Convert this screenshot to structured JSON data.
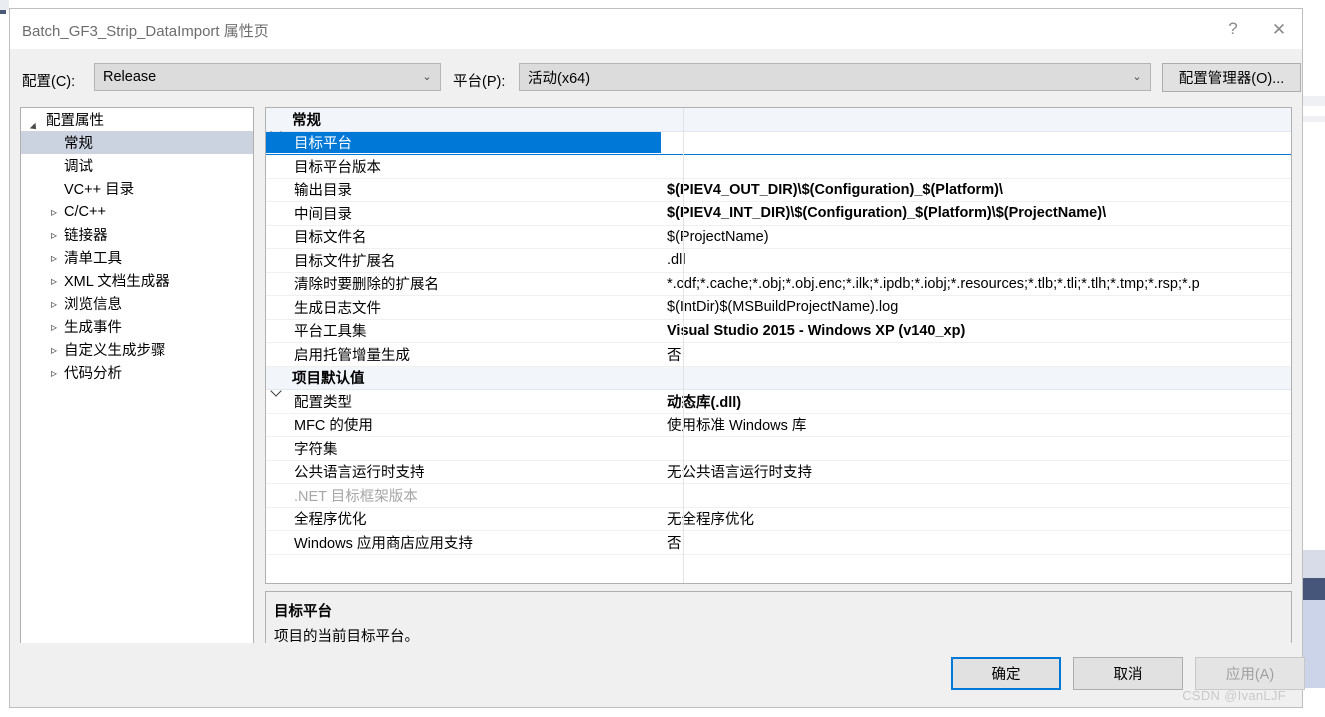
{
  "window": {
    "title": "Batch_GF3_Strip_DataImport 属性页",
    "help_icon": "question-mark-icon",
    "help_label": "?",
    "close_icon": "close-icon",
    "close_label": "✕"
  },
  "config_bar": {
    "configuration_label": "配置(C):",
    "configuration_value": "Release",
    "platform_label": "平台(P):",
    "platform_value": "活动(x64)",
    "config_manager_button": "配置管理器(O)...",
    "dropdown_arrow": "⌄"
  },
  "tree": {
    "items": [
      {
        "label": "配置属性",
        "level": 0,
        "state": "expanded",
        "selected": false
      },
      {
        "label": "常规",
        "level": 1,
        "state": "leaf",
        "selected": true
      },
      {
        "label": "调试",
        "level": 1,
        "state": "leaf",
        "selected": false
      },
      {
        "label": "VC++ 目录",
        "level": 1,
        "state": "leaf",
        "selected": false
      },
      {
        "label": "C/C++",
        "level": 1,
        "state": "collapsed",
        "selected": false
      },
      {
        "label": "链接器",
        "level": 1,
        "state": "collapsed",
        "selected": false
      },
      {
        "label": "清单工具",
        "level": 1,
        "state": "collapsed",
        "selected": false
      },
      {
        "label": "XML 文档生成器",
        "level": 1,
        "state": "collapsed",
        "selected": false
      },
      {
        "label": "浏览信息",
        "level": 1,
        "state": "collapsed",
        "selected": false
      },
      {
        "label": "生成事件",
        "level": 1,
        "state": "collapsed",
        "selected": false
      },
      {
        "label": "自定义生成步骤",
        "level": 1,
        "state": "collapsed",
        "selected": false
      },
      {
        "label": "代码分析",
        "level": 1,
        "state": "collapsed",
        "selected": false
      }
    ]
  },
  "grid": {
    "rows": [
      {
        "type": "group",
        "label": "常规",
        "value": ""
      },
      {
        "type": "prop",
        "label": "目标平台",
        "value": "",
        "selected": true,
        "bold": false
      },
      {
        "type": "prop",
        "label": "目标平台版本",
        "value": "",
        "bold": false
      },
      {
        "type": "prop",
        "label": "输出目录",
        "value": "$(PIEV4_OUT_DIR)\\$(Configuration)_$(Platform)\\",
        "bold": true
      },
      {
        "type": "prop",
        "label": "中间目录",
        "value": "$(PIEV4_INT_DIR)\\$(Configuration)_$(Platform)\\$(ProjectName)\\",
        "bold": true
      },
      {
        "type": "prop",
        "label": "目标文件名",
        "value": "$(ProjectName)",
        "bold": false
      },
      {
        "type": "prop",
        "label": "目标文件扩展名",
        "value": ".dll",
        "bold": false
      },
      {
        "type": "prop",
        "label": "清除时要删除的扩展名",
        "value": "*.cdf;*.cache;*.obj;*.obj.enc;*.ilk;*.ipdb;*.iobj;*.resources;*.tlb;*.tli;*.tlh;*.tmp;*.rsp;*.p",
        "bold": false
      },
      {
        "type": "prop",
        "label": "生成日志文件",
        "value": "$(IntDir)$(MSBuildProjectName).log",
        "bold": false
      },
      {
        "type": "prop",
        "label": "平台工具集",
        "value": "Visual Studio 2015 - Windows XP (v140_xp)",
        "bold": true
      },
      {
        "type": "prop",
        "label": "启用托管增量生成",
        "value": "否",
        "bold": false
      },
      {
        "type": "group",
        "label": "项目默认值",
        "value": ""
      },
      {
        "type": "prop",
        "label": "配置类型",
        "value": "动态库(.dll)",
        "bold": true
      },
      {
        "type": "prop",
        "label": "MFC 的使用",
        "value": "使用标准 Windows 库",
        "bold": false
      },
      {
        "type": "prop",
        "label": "字符集",
        "value": "",
        "bold": false
      },
      {
        "type": "prop",
        "label": "公共语言运行时支持",
        "value": "无公共语言运行时支持",
        "bold": false
      },
      {
        "type": "prop",
        "label": ".NET 目标框架版本",
        "value": "",
        "bold": false,
        "disabled": true
      },
      {
        "type": "prop",
        "label": "全程序优化",
        "value": "无全程序优化",
        "bold": false
      },
      {
        "type": "prop",
        "label": "Windows 应用商店应用支持",
        "value": "否",
        "bold": false
      }
    ]
  },
  "description": {
    "title": "目标平台",
    "body": "项目的当前目标平台。"
  },
  "footer": {
    "ok_label": "确定",
    "cancel_label": "取消",
    "apply_label": "应用(A)"
  },
  "watermark": "CSDN @IvanLJF",
  "colors": {
    "selection_blue": "#0078d7",
    "tree_selection": "#cbd3e0",
    "group_header_bg": "#f2f5fa",
    "dialog_bg": "#f0f0f0"
  }
}
